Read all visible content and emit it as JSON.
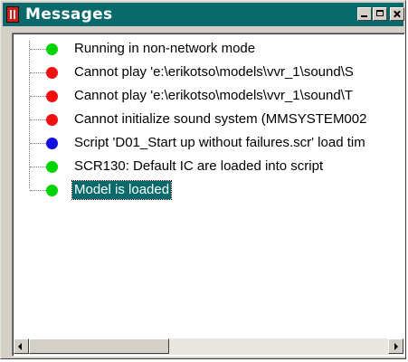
{
  "window": {
    "title": "Messages"
  },
  "messages": [
    {
      "text": "Running in non-network mode",
      "status": "green",
      "color": "#00d400"
    },
    {
      "text": "Cannot play 'e:\\erikotso\\models\\vvr_1\\sound\\S",
      "status": "red",
      "color": "#f01010"
    },
    {
      "text": "Cannot play 'e:\\erikotso\\models\\vvr_1\\sound\\T",
      "status": "red",
      "color": "#f01010"
    },
    {
      "text": "Cannot initialize sound system (MMSYSTEM002",
      "status": "red",
      "color": "#f01010"
    },
    {
      "text": "Script 'D01_Start up without  failures.scr' load tim",
      "status": "blue",
      "color": "#1010e0"
    },
    {
      "text": "SCR130: Default IC are loaded into script",
      "status": "green",
      "color": "#00d400"
    },
    {
      "text": "Model is loaded",
      "status": "green",
      "color": "#00d400",
      "selected": true
    }
  ],
  "colors": {
    "titlebar": "#0a6a6b",
    "selection": "#0a6a6b",
    "frame": "#d4d0c8"
  }
}
